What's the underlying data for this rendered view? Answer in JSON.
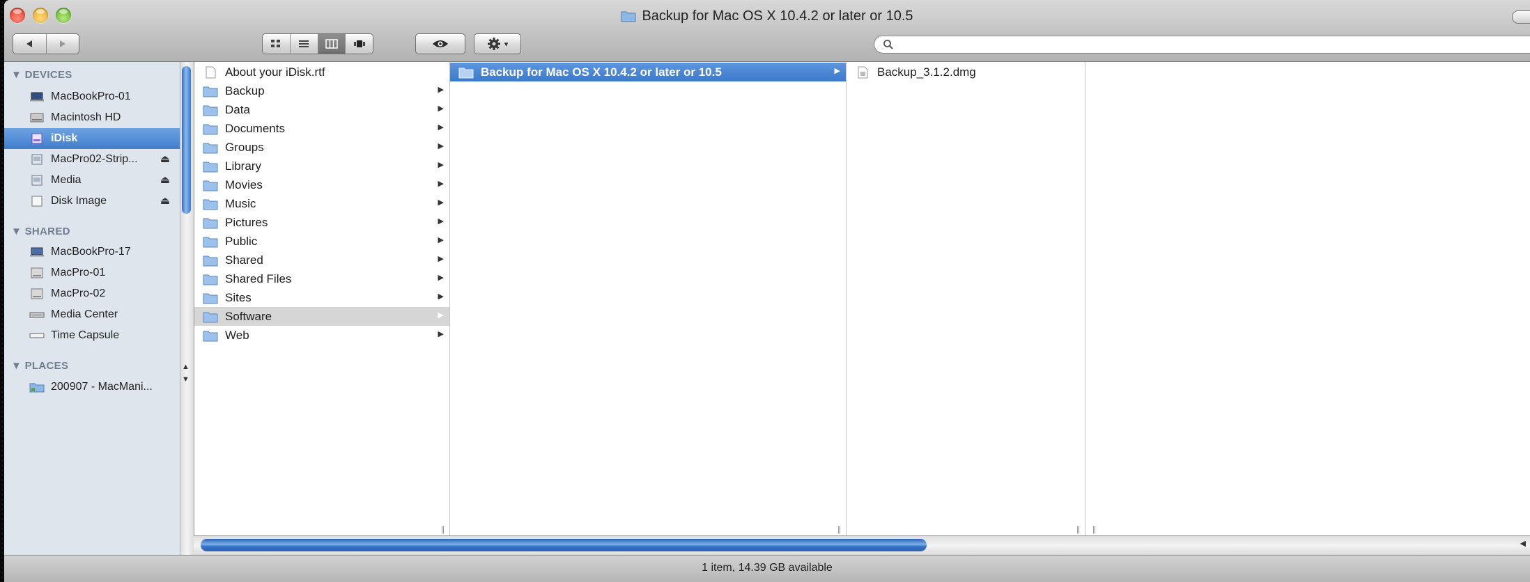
{
  "window": {
    "title": "Backup for Mac OS X 10.4.2 or later or 10.5"
  },
  "toolbar": {
    "back_icon": "triangle-left",
    "forward_icon": "triangle-right",
    "view_modes": [
      "icon-view",
      "list-view",
      "column-view",
      "cover-flow"
    ],
    "active_view": "column-view",
    "quicklook_icon": "eye-icon",
    "action_icon": "gear-icon",
    "search_placeholder": ""
  },
  "sidebar": {
    "devices_header": "▼ DEVICES",
    "devices": [
      {
        "label": "MacBookPro-01",
        "icon": "laptop-icon",
        "eject": false
      },
      {
        "label": "Macintosh HD",
        "icon": "hard-drive-icon",
        "eject": false
      },
      {
        "label": "iDisk",
        "icon": "idisk-icon",
        "eject": false,
        "selected": true
      },
      {
        "label": "MacPro02-Strip...",
        "icon": "disk-image-icon",
        "eject": true
      },
      {
        "label": "Media",
        "icon": "disk-image-icon",
        "eject": true
      },
      {
        "label": "Disk Image",
        "icon": "blank-disk-icon",
        "eject": true
      }
    ],
    "shared_header": "▼ SHARED",
    "shared": [
      {
        "label": "MacBookPro-17",
        "icon": "laptop-icon"
      },
      {
        "label": "MacPro-01",
        "icon": "server-icon"
      },
      {
        "label": "MacPro-02",
        "icon": "server-icon"
      },
      {
        "label": "Media Center",
        "icon": "media-center-icon"
      },
      {
        "label": "Time Capsule",
        "icon": "time-capsule-icon"
      }
    ],
    "places_header": "▼ PLACES",
    "places": [
      {
        "label": "200907 - MacMani...",
        "icon": "folder-icon"
      }
    ],
    "eject_glyph": "⏏"
  },
  "columns": {
    "col1": [
      {
        "label": "About your iDisk.rtf",
        "icon": "document-icon",
        "has_children": false
      },
      {
        "label": "Backup",
        "icon": "folder-icon",
        "has_children": true
      },
      {
        "label": "Data",
        "icon": "folder-icon",
        "has_children": true
      },
      {
        "label": "Documents",
        "icon": "folder-icon",
        "has_children": true
      },
      {
        "label": "Groups",
        "icon": "folder-icon",
        "has_children": true
      },
      {
        "label": "Library",
        "icon": "folder-icon",
        "has_children": true
      },
      {
        "label": "Movies",
        "icon": "folder-icon",
        "has_children": true
      },
      {
        "label": "Music",
        "icon": "folder-icon",
        "has_children": true
      },
      {
        "label": "Pictures",
        "icon": "folder-icon",
        "has_children": true
      },
      {
        "label": "Public",
        "icon": "folder-icon",
        "has_children": true
      },
      {
        "label": "Shared",
        "icon": "folder-icon",
        "has_children": true
      },
      {
        "label": "Shared Files",
        "icon": "folder-icon",
        "has_children": true
      },
      {
        "label": "Sites",
        "icon": "folder-icon",
        "has_children": true
      },
      {
        "label": "Software",
        "icon": "folder-icon",
        "has_children": true,
        "selected": "inactive"
      },
      {
        "label": "Web",
        "icon": "folder-icon",
        "has_children": true
      }
    ],
    "col2": [
      {
        "label": "Backup for Mac OS X 10.4.2 or later or 10.5",
        "icon": "folder-icon",
        "has_children": true,
        "selected": "active"
      }
    ],
    "col3": [
      {
        "label": "Backup_3.1.2.dmg",
        "icon": "dmg-icon",
        "has_children": false
      }
    ],
    "arrow_glyph": "▶"
  },
  "status": {
    "text": "1 item, 14.39 GB available"
  },
  "colors": {
    "selection_active": "#3c79cc",
    "selection_inactive": "#d6d6d6",
    "sidebar_bg": "#dfe5ed",
    "sidebar_header": "#6f7d8f"
  }
}
